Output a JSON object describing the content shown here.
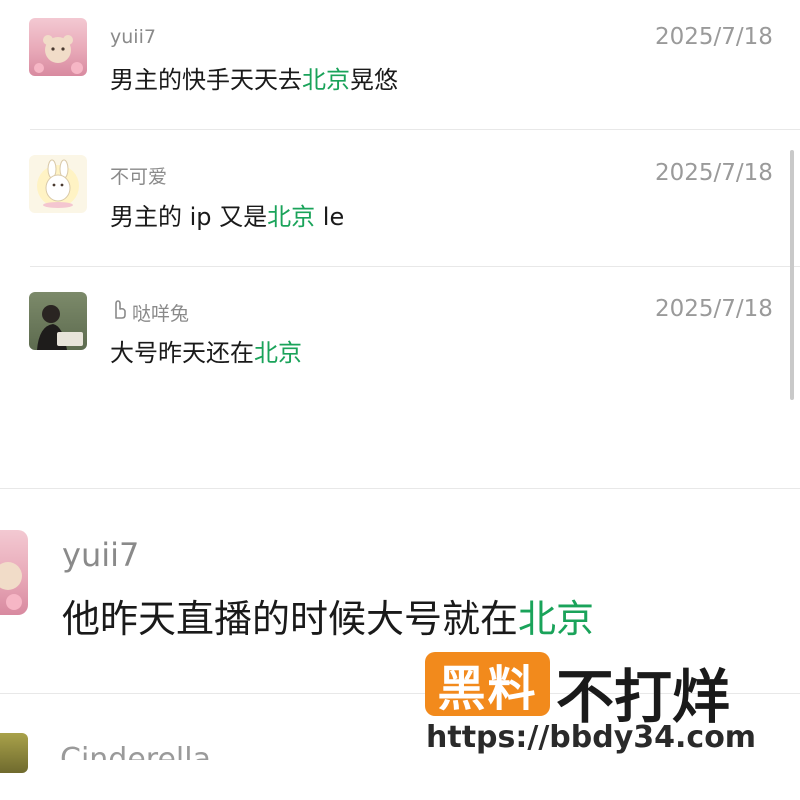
{
  "colors": {
    "highlight": "#1aa35a",
    "meta": "#9a9a9a",
    "text": "#1a1a1a",
    "watermark_bg": "#f28a1c"
  },
  "comments": [
    {
      "username": "yuii7",
      "date": "2025/7/18",
      "text_before": "男主的快手天天去",
      "highlight": "北京",
      "text_after": "晃悠",
      "avatar": "bear-in-flowers-avatar"
    },
    {
      "username": "不可爱",
      "date": "2025/7/18",
      "text_before": "男主的 ip 又是",
      "highlight": "北京",
      "text_after": " le",
      "avatar": "cartoon-bunny-avatar"
    },
    {
      "username": "哒咩兔",
      "date": "2025/7/18",
      "text_before": "大号昨天还在",
      "highlight": "北京",
      "text_after": "",
      "avatar": "person-reading-avatar",
      "badge_icon": "hand-icon"
    }
  ],
  "zoomed_comment": {
    "username": "yuii7",
    "text_before": "他昨天直播的时候大号就在",
    "highlight": "北京",
    "text_after": ""
  },
  "partial_comment": {
    "username": "Cinderella"
  },
  "watermark": {
    "badge": "黑料",
    "text": "不打烊",
    "url": "https://bbdy34.com"
  }
}
